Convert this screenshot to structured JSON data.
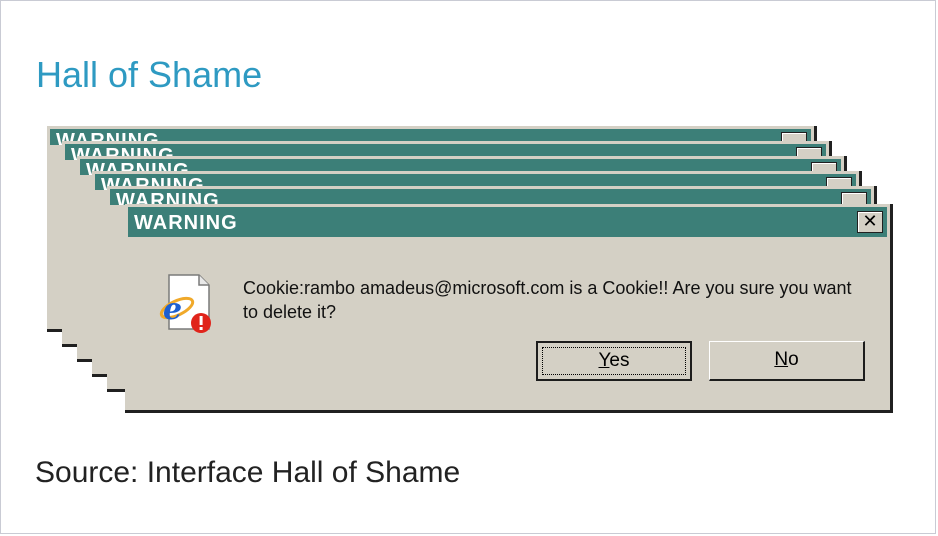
{
  "page": {
    "heading": "Hall of Shame",
    "caption": "Source: Interface Hall of Shame"
  },
  "dialog": {
    "title": "WARNING",
    "close_label": "✕",
    "message": "Cookie:rambo amadeus@microsoft.com is a Cookie!! Are you sure you want to delete it?",
    "icon": "ie-document-error-icon",
    "buttons": {
      "yes_underline": "Y",
      "yes_rest": "es",
      "no_underline": "N",
      "no_rest": "o"
    }
  },
  "stacked_dialog_count": 6
}
